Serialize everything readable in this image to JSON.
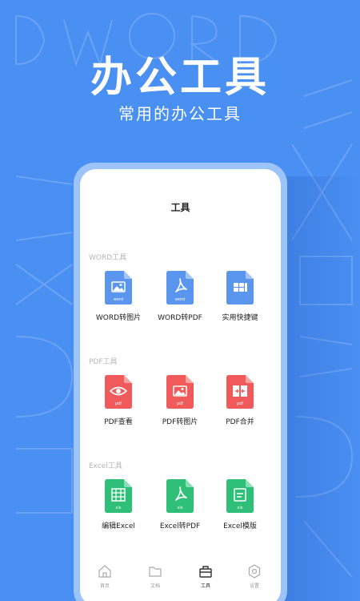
{
  "hero": {
    "title": "办公工具",
    "subtitle": "常用的办公工具"
  },
  "screen": {
    "title": "工具",
    "sections": [
      {
        "label": "WORD工具",
        "color": "#5b96ee",
        "tools": [
          {
            "label": "WORD转图片",
            "icon": "image-icon",
            "badge": "word"
          },
          {
            "label": "WORD转PDF",
            "icon": "pdf-icon",
            "badge": "word"
          },
          {
            "label": "实用快捷键",
            "icon": "shortcut-icon",
            "badge": ""
          }
        ]
      },
      {
        "label": "PDF工具",
        "color": "#f05a5a",
        "tools": [
          {
            "label": "PDF查看",
            "icon": "eye-icon",
            "badge": "pdf"
          },
          {
            "label": "PDF转图片",
            "icon": "image-icon",
            "badge": "pdf"
          },
          {
            "label": "PDF合并",
            "icon": "merge-icon",
            "badge": "pdf"
          }
        ]
      },
      {
        "label": "Excel工具",
        "color": "#2fbf78",
        "tools": [
          {
            "label": "编辑Excel",
            "icon": "grid-icon",
            "badge": "xls"
          },
          {
            "label": "Excel转PDF",
            "icon": "pdf-icon",
            "badge": "xls"
          },
          {
            "label": "Excel模版",
            "icon": "template-icon",
            "badge": "xls"
          }
        ]
      }
    ]
  },
  "tabbar": {
    "items": [
      {
        "label": "首页",
        "icon": "home-icon",
        "active": false
      },
      {
        "label": "文档",
        "icon": "folder-icon",
        "active": false
      },
      {
        "label": "工具",
        "icon": "toolbox-icon",
        "active": true
      },
      {
        "label": "设置",
        "icon": "settings-icon",
        "active": false
      }
    ]
  }
}
